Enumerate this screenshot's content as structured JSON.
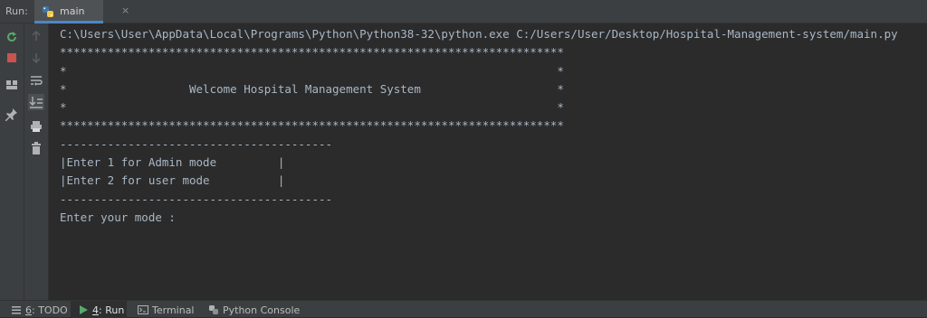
{
  "toolwindow": {
    "label": "Run:"
  },
  "tab": {
    "label": "main",
    "close": "×"
  },
  "console": {
    "lines": [
      "C:\\Users\\User\\AppData\\Local\\Programs\\Python\\Python38-32\\python.exe C:/Users/User/Desktop/Hospital-Management-system/main.py",
      "**************************************************************************",
      "*                                                                        *",
      "*                  Welcome Hospital Management System                    *",
      "*                                                                        *",
      "**************************************************************************",
      "----------------------------------------",
      "|Enter 1 for Admin mode         |",
      "|Enter 2 for user mode          |",
      "----------------------------------------",
      "Enter your mode :"
    ]
  },
  "statusbar": {
    "todo": {
      "number": "6",
      "label": ": TODO"
    },
    "run": {
      "number": "4",
      "label": ": Run"
    },
    "terminal": "Terminal",
    "python_console": "Python Console"
  },
  "icons": {
    "rerun": "rerun-icon",
    "stop": "stop-icon",
    "layout": "layout-icon",
    "pin": "pin-icon",
    "up": "up-arrow-icon",
    "down": "down-arrow-icon",
    "wrap": "soft-wrap-icon",
    "scroll": "scroll-to-end-icon",
    "print": "print-icon",
    "trash": "trash-icon"
  }
}
